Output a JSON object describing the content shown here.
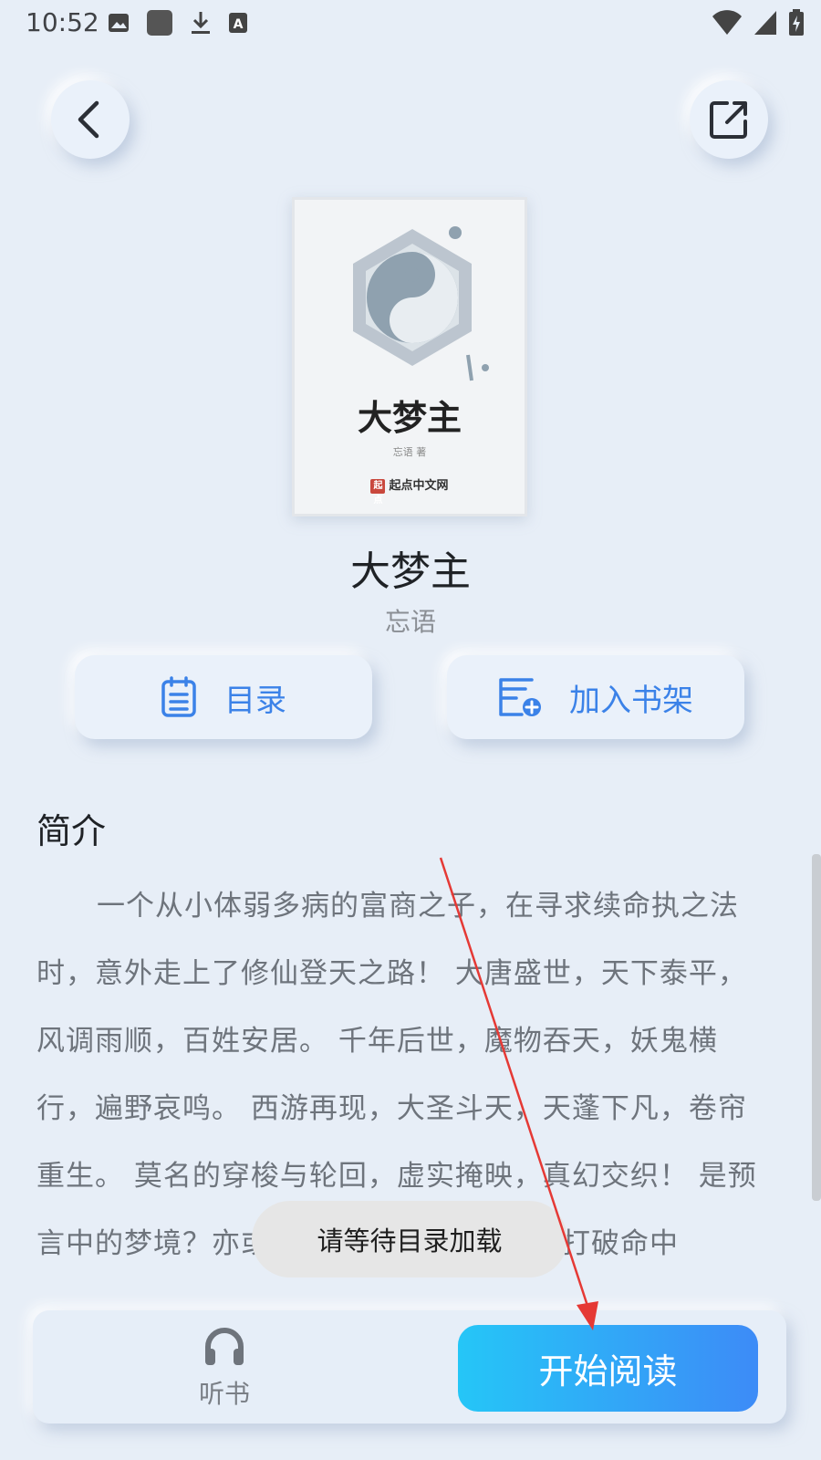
{
  "status_bar": {
    "time": "10:52"
  },
  "book": {
    "title": "大梦主",
    "author": "忘语",
    "cover": {
      "title": "大梦主",
      "author_line": "忘语 著",
      "publisher": "起点中文网",
      "seal": "起点"
    }
  },
  "actions": {
    "toc_label": "目录",
    "add_shelf_label": "加入书架"
  },
  "intro": {
    "heading": "简介",
    "text": "一个从小体弱多病的富商之子，在寻求续命执之法时，意外走上了修仙登天之路！ 大唐盛世，天下泰平，风调雨顺，百姓安居。 千年后世，魔物吞天，妖鬼横行，遍野哀鸣。 西游再现，大圣斗天，天蓬下凡，卷帘重生。 莫名的穿梭与轮回，虚实掩映，真幻交织！ 是预言中的梦境？亦或是真实的过往？他能否打破命中"
  },
  "toast": {
    "message": "请等待目录加载"
  },
  "bottom_bar": {
    "listen_label": "听书",
    "read_label": "开始阅读"
  },
  "colors": {
    "accent": "#3B82E8",
    "annotation_arrow": "#E53935"
  }
}
